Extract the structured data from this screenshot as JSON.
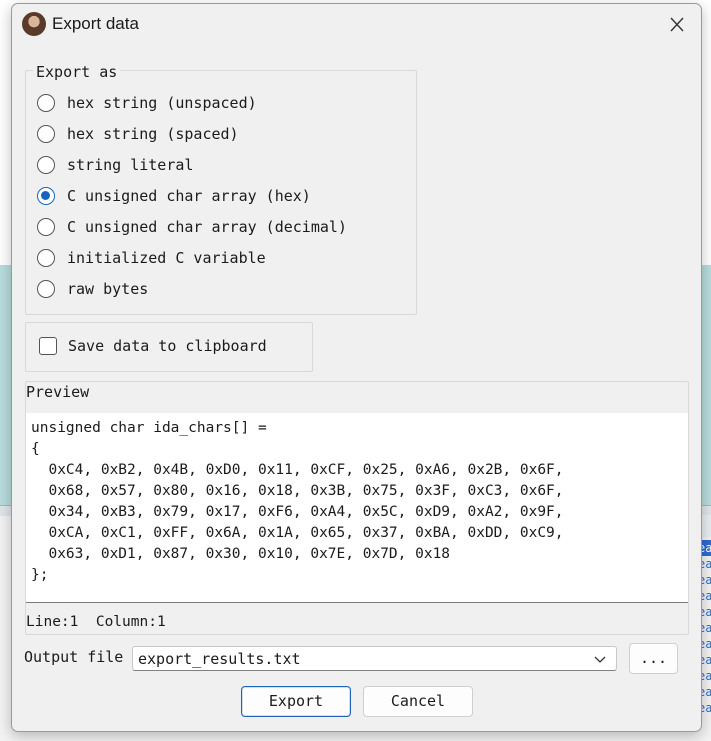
{
  "window": {
    "title": "Export data"
  },
  "export_as": {
    "legend": "Export as",
    "options": [
      {
        "label": "hex string (unspaced)",
        "checked": false
      },
      {
        "label": "hex string (spaced)",
        "checked": false
      },
      {
        "label": "string literal",
        "checked": false
      },
      {
        "label": "C unsigned char array (hex)",
        "checked": true
      },
      {
        "label": "C unsigned char array (decimal)",
        "checked": false
      },
      {
        "label": "initialized C variable",
        "checked": false
      },
      {
        "label": "raw bytes",
        "checked": false
      }
    ]
  },
  "clipboard": {
    "label": "Save data to clipboard",
    "checked": false
  },
  "preview": {
    "label": "Preview",
    "lines": [
      "unsigned char ida_chars[] =",
      "{",
      "  0xC4, 0xB2, 0x4B, 0xD0, 0x11, 0xCF, 0x25, 0xA6, 0x2B, 0x6F,",
      "  0x68, 0x57, 0x80, 0x16, 0x18, 0x3B, 0x75, 0x3F, 0xC3, 0x6F,",
      "  0x34, 0xB3, 0x79, 0x17, 0xF6, 0xA4, 0x5C, 0xD9, 0xA2, 0x9F,",
      "  0xCA, 0xC1, 0xFF, 0x6A, 0x1A, 0x65, 0x37, 0xBA, 0xDD, 0xC9,",
      "  0x63, 0xD1, 0x87, 0x30, 0x10, 0x7E, 0x7D, 0x18",
      "};"
    ],
    "status": "Line:1  Column:1"
  },
  "output": {
    "label": "Output file",
    "value": "export_results.txt",
    "browse_label": "..."
  },
  "buttons": {
    "export": "Export",
    "cancel": "Cancel"
  },
  "background": {
    "fragment_text": "ea"
  },
  "colors": {
    "accent": "#1565c0",
    "dialog_bg": "#f0f0f0",
    "background_teal": "#b9dcdd"
  }
}
